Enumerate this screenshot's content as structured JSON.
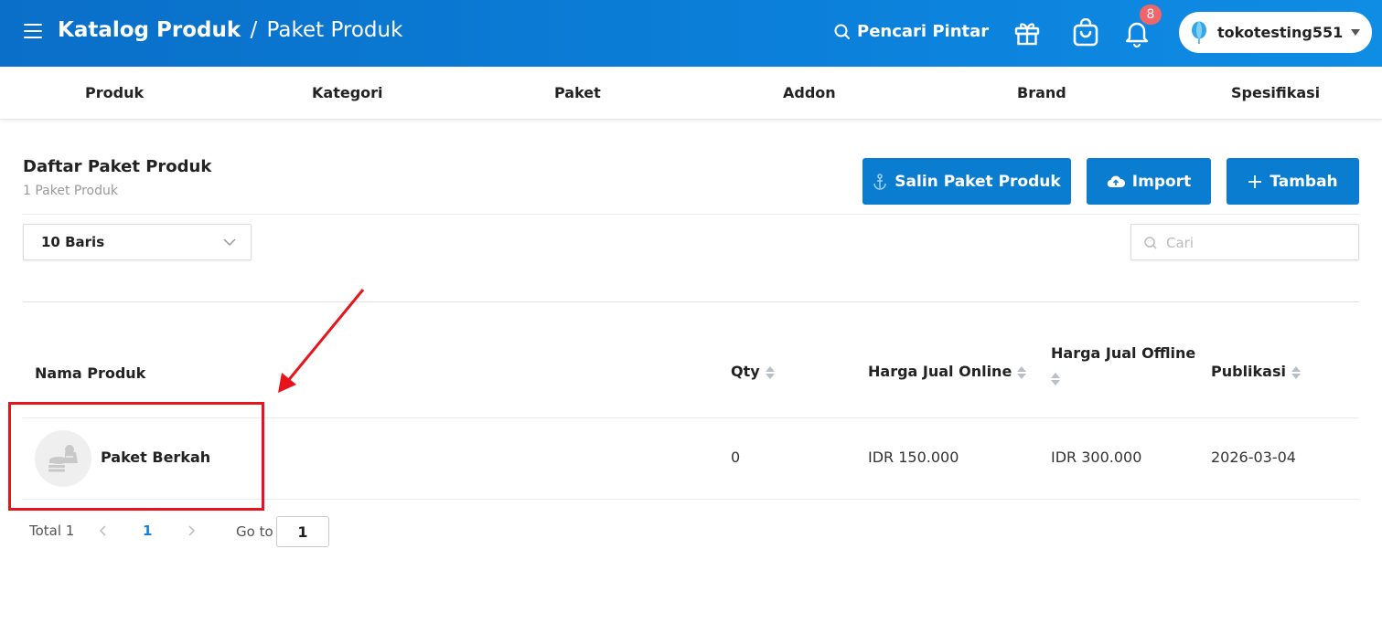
{
  "header": {
    "title_main": "Katalog Produk",
    "title_sep": "/",
    "title_sub": "Paket Produk",
    "smart_search": "Pencari Pintar",
    "notification_count": "8",
    "store_name": "tokotesting551",
    "icons": [
      "menu-icon",
      "search-icon",
      "gift-icon",
      "bag-icon",
      "bell-icon",
      "balloon-icon",
      "chevron-down-icon"
    ]
  },
  "tabs": [
    "Produk",
    "Kategori",
    "Paket",
    "Addon",
    "Brand",
    "Spesifikasi"
  ],
  "list": {
    "title": "Daftar Paket Produk",
    "count": "1 Paket Produk"
  },
  "actions": {
    "copy_label": "Salin Paket Produk",
    "import_label": "Import",
    "add_label": "Tambah"
  },
  "filters": {
    "rows_value": "10 Baris",
    "search_placeholder": "Cari"
  },
  "table": {
    "columns": {
      "name": "Nama Produk",
      "qty": "Qty",
      "online": "Harga Jual Online",
      "offline": "Harga Jual Offline",
      "publish": "Publikasi"
    },
    "rows": [
      {
        "name": "Paket Berkah",
        "qty": "0",
        "online": "IDR 150.000",
        "offline": "IDR 300.000",
        "publish": "2026-03-04"
      }
    ]
  },
  "pagination": {
    "total_label": "Total 1",
    "current_page": "1",
    "goto_label": "Go to",
    "goto_value": "1"
  },
  "colors": {
    "header_bg": "#0b7dd6",
    "button_bg": "#0b7dd0",
    "badge": "#f0646a",
    "annotation": "#e8141b",
    "active_page": "#1a7fd6"
  }
}
